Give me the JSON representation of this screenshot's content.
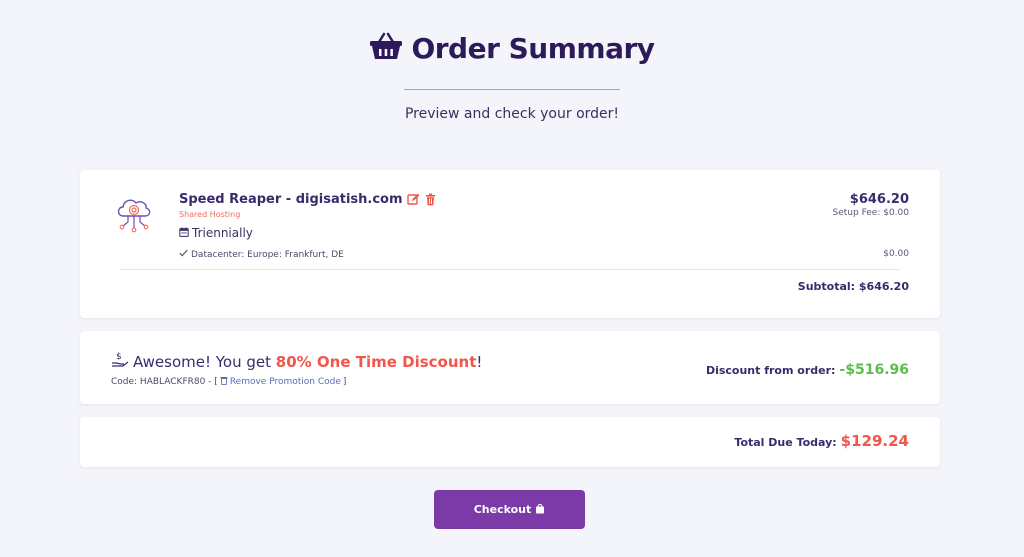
{
  "header": {
    "title": "Order Summary",
    "subtitle": "Preview and check your order!",
    "icon": "basket-icon"
  },
  "product": {
    "icon": "cloud-hosting-icon",
    "name": "Speed Reaper - digisatish.com",
    "group": "Shared Hosting",
    "billing_cycle": "Triennially",
    "price": "$646.20",
    "setup_fee": "Setup Fee: $0.00",
    "datacenter": "Datacenter: Europe: Frankfurt, DE",
    "datacenter_price": "$0.00",
    "subtotal": "Subtotal: $646.20"
  },
  "promo": {
    "headline_prefix": "Awesome! You get ",
    "headline_highlight": "80% One Time Discount",
    "headline_suffix": "!",
    "code_text": "Code: HABLACKFR80 - [",
    "remove_label": "Remove Promotion Code",
    "code_close": "]",
    "discount_label": "Discount from order:",
    "discount_amount": "-$516.96"
  },
  "total": {
    "label": "Total Due Today:",
    "amount": "$129.24"
  },
  "checkout": {
    "label": "Checkout"
  },
  "colors": {
    "accent": "#7c3aa8",
    "title": "#2c1a5a",
    "coral": "#f2554a",
    "green": "#5bbf4a"
  }
}
